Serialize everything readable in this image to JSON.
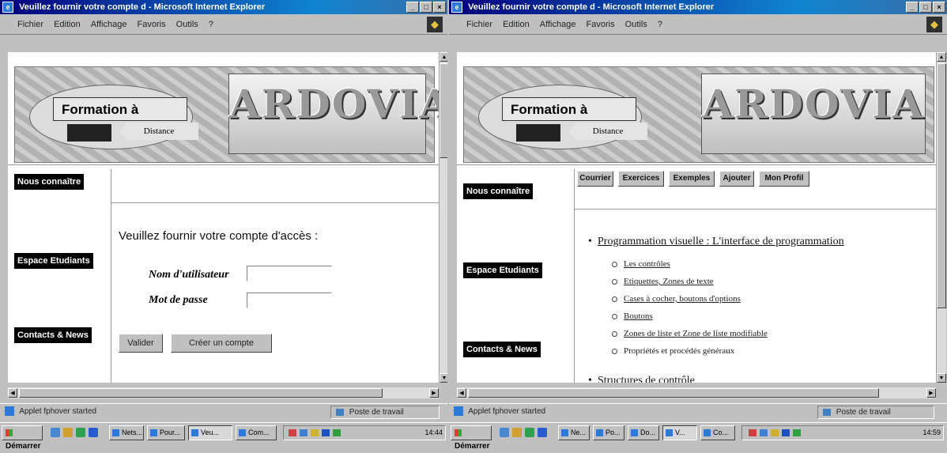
{
  "left": {
    "title": "Veuillez fournir votre compte d - Microsoft Internet Explorer",
    "menu": [
      "Fichier",
      "Edition",
      "Affichage",
      "Favoris",
      "Outils",
      "?"
    ],
    "banner": {
      "formation": "Formation à",
      "distance": "Distance",
      "logo": "ARDOVIA"
    },
    "nav": [
      "Nous connaître",
      "Espace Etudiants",
      "Contacts & News"
    ],
    "prompt": "Veuillez fournir votre compte d'accès :",
    "username_label": "Nom d'utilisateur",
    "password_label": "Mot de passe",
    "validate": "Valider",
    "create_account": "Créer un compte",
    "status": "Applet fphover started",
    "zone": "Poste de travail"
  },
  "right": {
    "title": "Veuillez fournir votre compte d - Microsoft Internet Explorer",
    "menu": [
      "Fichier",
      "Edition",
      "Affichage",
      "Favoris",
      "Outils",
      "?"
    ],
    "banner": {
      "formation": "Formation à",
      "distance": "Distance",
      "logo": "ARDOVIA"
    },
    "nav": [
      "Nous connaître",
      "Espace Etudiants",
      "Contacts & News"
    ],
    "toolbar": [
      "Courrier",
      "Exercices",
      "Exemples",
      "Ajouter",
      "Mon Profil"
    ],
    "course_title": "Programmation visuelle : L'interface de programmation",
    "lessons": [
      {
        "label": "Les contrôles",
        "link": true
      },
      {
        "label": "Etiquettes, Zones de texte",
        "link": true
      },
      {
        "label": "Cases à cocher, boutons d'options",
        "link": true
      },
      {
        "label": "Boutons",
        "link": true
      },
      {
        "label": "Zones de liste et Zone de liste modifiable",
        "link": true
      },
      {
        "label": "Propriétés et procédés généraux",
        "link": false
      }
    ],
    "next_section": "Structures de contrôle",
    "status": "Applet fphover started",
    "zone": "Poste de travail"
  },
  "taskbar_left": {
    "start": "Démarrer",
    "tasks": [
      "Nets...",
      "Pour...",
      "Veu...",
      "Com..."
    ],
    "clock": "14:44"
  },
  "taskbar_right": {
    "start": "Démarrer",
    "tasks": [
      "Ne...",
      "Po...",
      "Do...",
      "V...",
      "Co..."
    ],
    "clock": "14:59"
  }
}
